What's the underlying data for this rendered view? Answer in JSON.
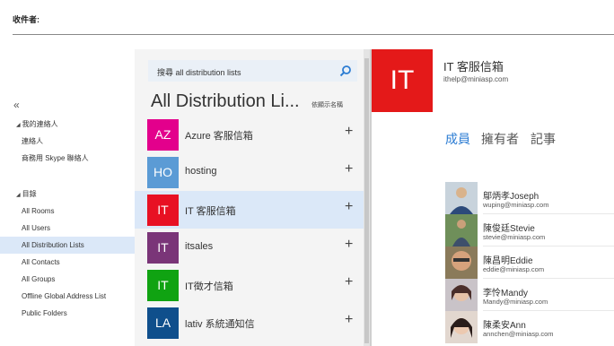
{
  "recipient": {
    "label": "收件者:"
  },
  "nav": {
    "collapse_glyph": "«",
    "my_contacts": {
      "label": "我的連絡人",
      "items": [
        "連絡人",
        "商務用 Skype 聯絡人"
      ]
    },
    "directory": {
      "label": "目錄",
      "items": [
        "All Rooms",
        "All Users",
        "All Distribution Lists",
        "All Contacts",
        "All Groups",
        "Offline Global Address List",
        "Public Folders"
      ]
    },
    "selected": "All Distribution Lists"
  },
  "list": {
    "search_placeholder": "搜尋 all distribution lists",
    "title": "All Distribution Li...",
    "sort_label": "依顯示名稱",
    "plus_glyph": "+",
    "groups": [
      {
        "initials": "AZ",
        "name": "Azure 客服信箱",
        "color": "#e3008c"
      },
      {
        "initials": "HO",
        "name": "hosting",
        "color": "#5b9bd5"
      },
      {
        "initials": "IT",
        "name": "IT 客服信箱",
        "color": "#e81123"
      },
      {
        "initials": "IT",
        "name": "itsales",
        "color": "#7a3578"
      },
      {
        "initials": "IT",
        "name": "IT徵才信箱",
        "color": "#10a312"
      },
      {
        "initials": "LA",
        "name": "lativ 系統通知信",
        "color": "#0f4f8c"
      }
    ]
  },
  "detail": {
    "initials": "IT",
    "name": "IT 客服信箱",
    "email": "ithelp@miniasp.com",
    "tabs": [
      "成員",
      "擁有者",
      "記事"
    ],
    "active_tab": "成員",
    "members": [
      {
        "name": "鄔炳孝Joseph",
        "email": "wuping@miniasp.com"
      },
      {
        "name": "陳俊廷Stevie",
        "email": "stevie@miniasp.com"
      },
      {
        "name": "陳昌明Eddie",
        "email": "eddie@miniasp.com"
      },
      {
        "name": "李怜Mandy",
        "email": "Mandy@miniasp.com"
      },
      {
        "name": "陳柔安Ann",
        "email": "annchen@miniasp.com"
      }
    ]
  }
}
